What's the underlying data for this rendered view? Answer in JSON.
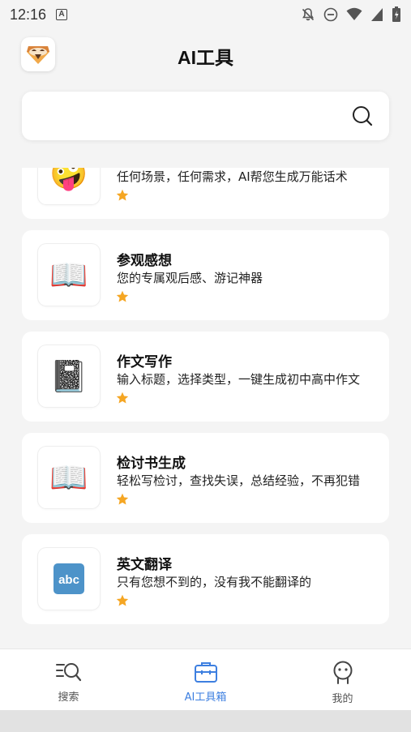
{
  "status_bar": {
    "time": "12:16",
    "notification_icon": "A"
  },
  "header": {
    "title": "AI工具",
    "logo_icon": "sloth-logo-icon"
  },
  "search": {
    "placeholder": "",
    "icon": "search-icon"
  },
  "tools": [
    {
      "emoji": "🤪",
      "name": "",
      "desc": "任何场景，任何需求，AI帮您生成万能话术",
      "rating": 1
    },
    {
      "emoji": "📖",
      "name": "参观感想",
      "desc": "您的专属观后感、游记神器",
      "rating": 1
    },
    {
      "emoji": "📓",
      "name": "作文写作",
      "desc": "输入标题，选择类型，一键生成初中高中作文",
      "rating": 1
    },
    {
      "emoji": "📖",
      "name": "检讨书生成",
      "desc": "轻松写检讨，查找失误，总结经验，不再犯错",
      "rating": 1
    },
    {
      "emoji": "🔤",
      "name": "英文翻译",
      "desc": "只有您想不到的，没有我不能翻译的",
      "rating": 1
    }
  ],
  "bottom_nav": {
    "items": [
      {
        "label": "搜索",
        "icon": "search-list-icon",
        "active": false
      },
      {
        "label": "AI工具箱",
        "icon": "toolbox-icon",
        "active": true
      },
      {
        "label": "我的",
        "icon": "profile-icon",
        "active": false
      }
    ]
  },
  "colors": {
    "accent": "#3d7fe0",
    "star": "#f5a623",
    "background": "#f4f4f4"
  }
}
